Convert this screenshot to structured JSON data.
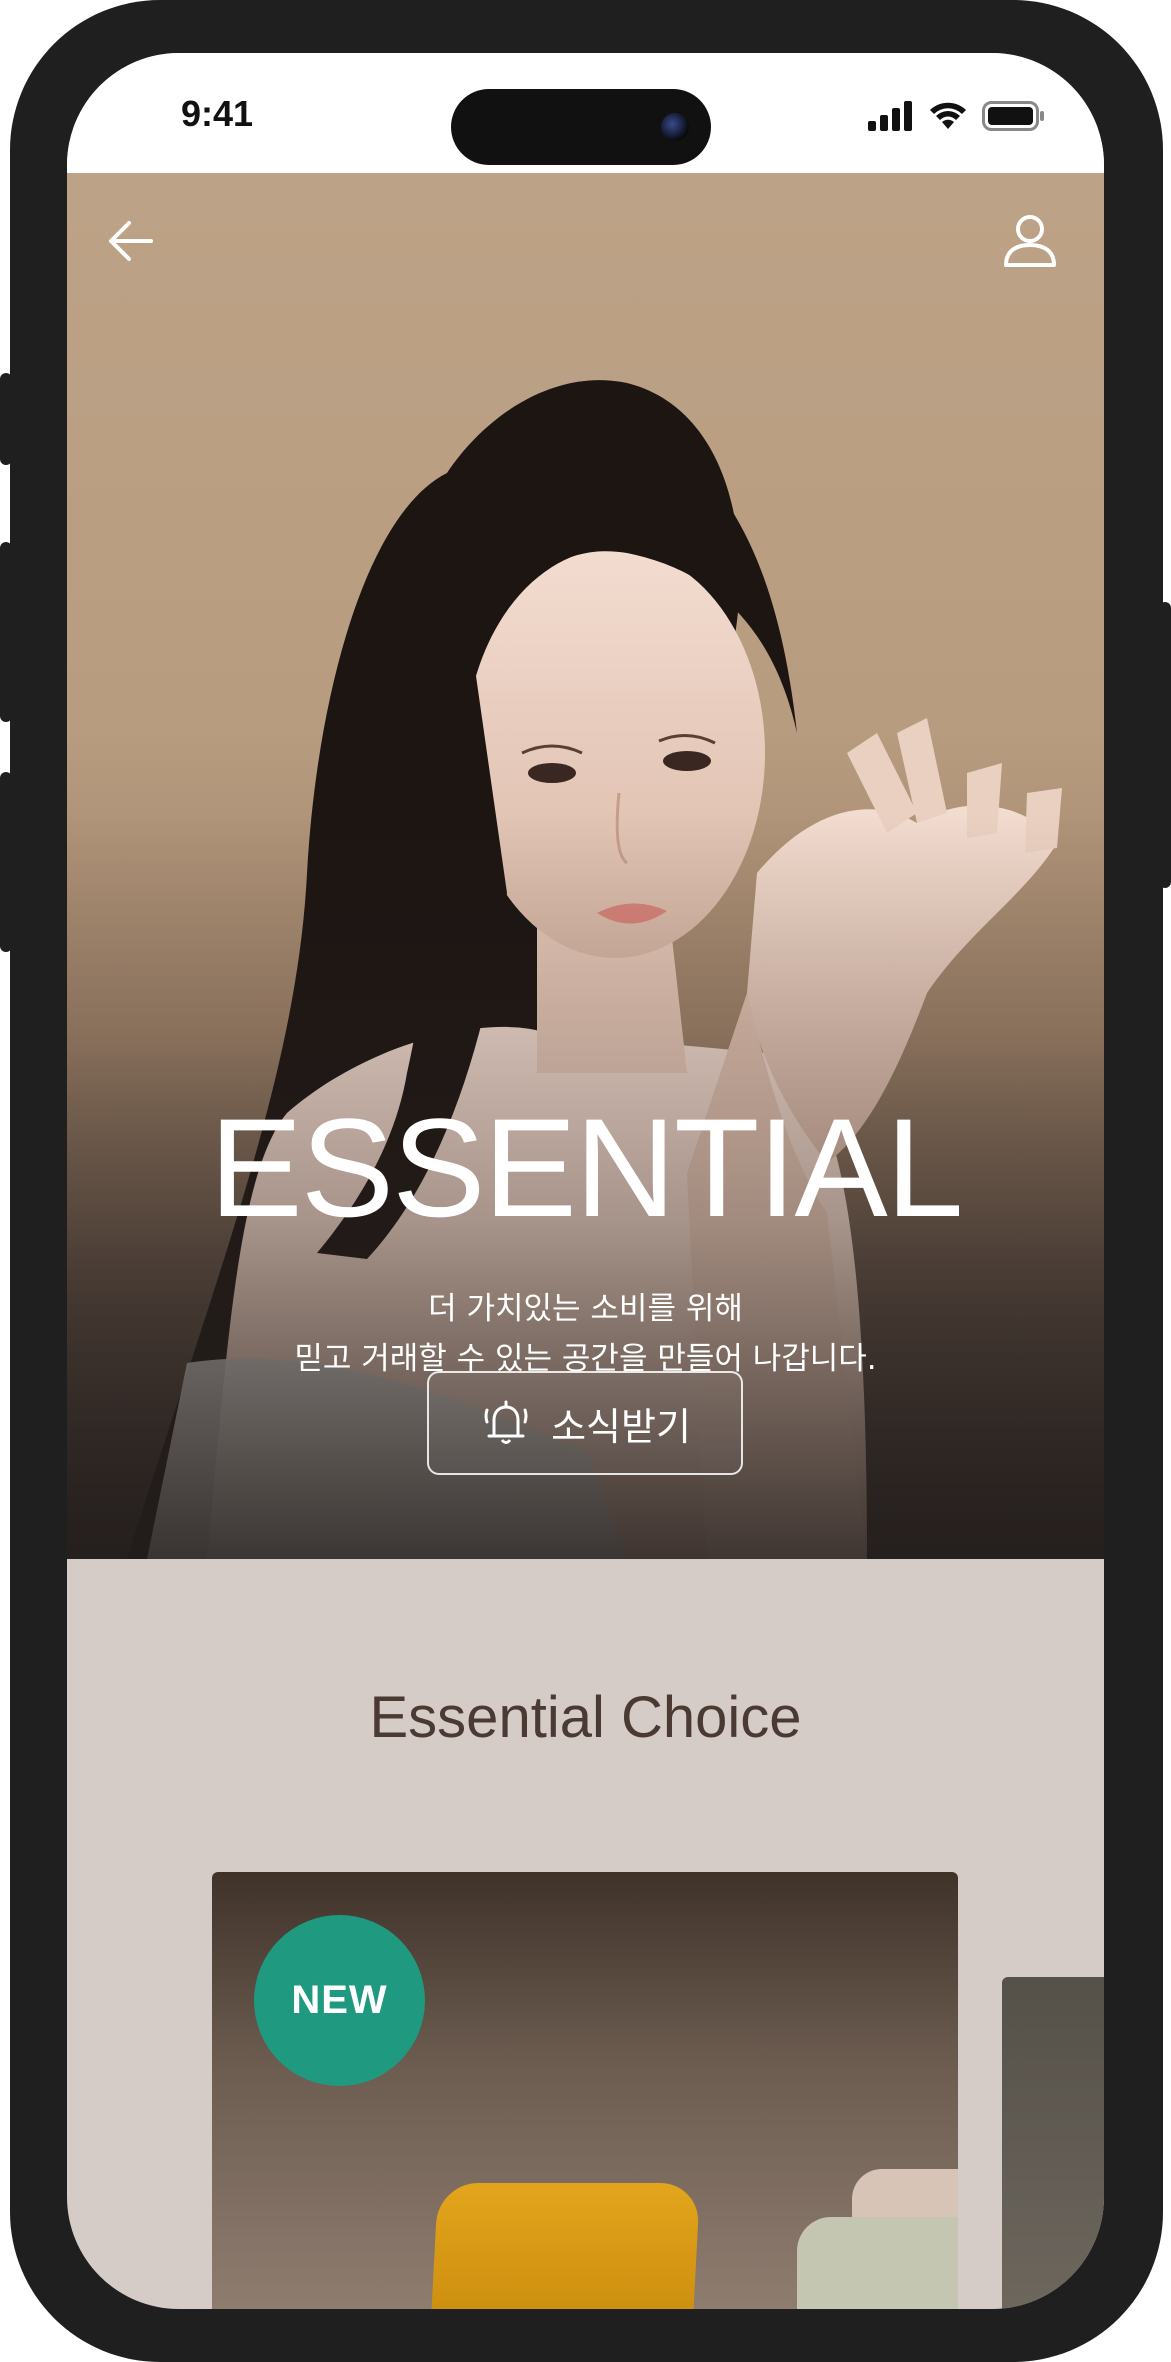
{
  "status_bar": {
    "time": "9:41"
  },
  "header": {
    "back_icon": "arrow-left-icon",
    "profile_icon": "user-icon"
  },
  "hero": {
    "title": "ESSENTIAL",
    "subtitle_line1": "더 가치있는 소비를 위해",
    "subtitle_line2": "믿고 거래할 수 있는 공간을 만들어 나갑니다.",
    "notify_icon": "bell-icon",
    "notify_label": "소식받기"
  },
  "section": {
    "title": "Essential Choice"
  },
  "products": [
    {
      "badge": "NEW"
    }
  ],
  "colors": {
    "hero_bg": "#bca286",
    "section_bg": "#d5ccc7",
    "badge": "#1f9a80",
    "section_title": "#4a3a33",
    "frame": "#1f1f1f"
  }
}
